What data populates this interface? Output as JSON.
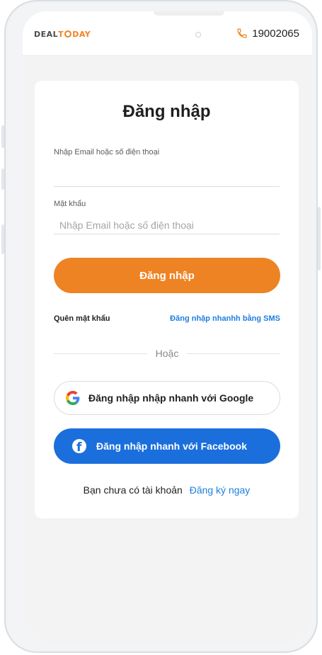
{
  "header": {
    "logo_text": "DEALTODAY",
    "logo_deal": "DEAL",
    "logo_to": "T",
    "logo_day": "DAY",
    "hotline": "19002065",
    "phone_icon": "phone-icon"
  },
  "login": {
    "title": "Đăng nhập",
    "email_label": "Nhập Email hoặc số điện thoại",
    "email_value": "",
    "password_label": "Mật khẩu",
    "password_placeholder": "Nhập Email hoặc số điện thoại",
    "submit_label": "Đăng nhập",
    "forgot_label": "Quên mật khẩu",
    "sms_label": "Đăng nhập nhanhh bằng SMS",
    "or_label": "Hoặc",
    "google_label": "Đăng nhập nhập nhanh với Google",
    "facebook_label": "Đăng nhập nhanh với Facebook",
    "no_account_text": "Bạn chưa có tài khoản",
    "register_label": "Đăng ký ngay"
  },
  "colors": {
    "accent_orange": "#ee8323",
    "facebook_blue": "#1b6fdc",
    "link_blue": "#1e7fe0"
  }
}
